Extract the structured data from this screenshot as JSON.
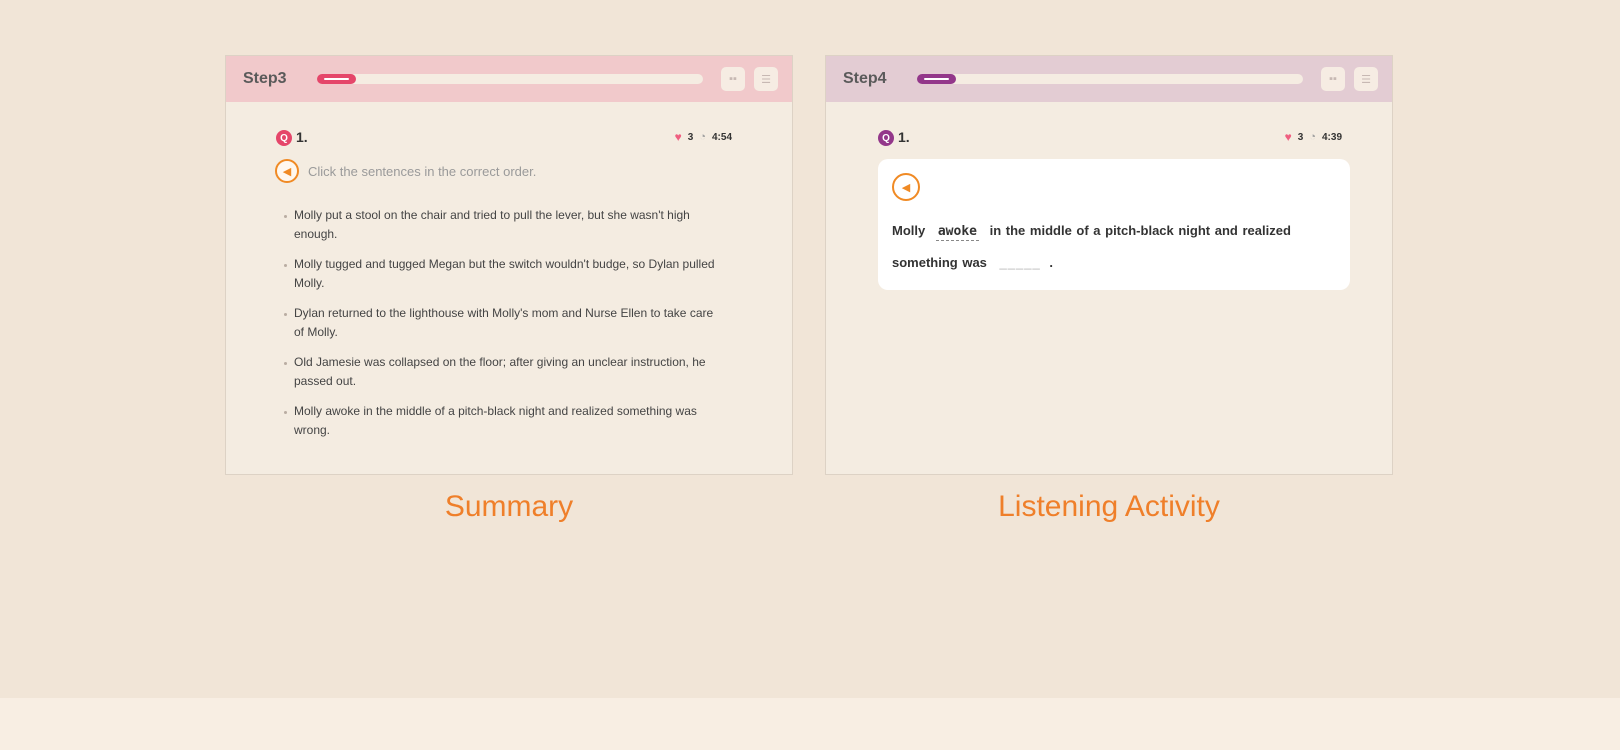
{
  "colors": {
    "background": "#f1e5d7",
    "accent_orange": "#ef7f2a",
    "step3_accent": "#e5466a",
    "step4_accent": "#93378a"
  },
  "summary_panel": {
    "step_title": "Step3",
    "progress_fraction": 0.1,
    "header_icons": [
      "grid-icon",
      "list-icon"
    ],
    "question_badge": "Q",
    "question_number": "1.",
    "hearts": "3",
    "timer": "4:54",
    "instruction": "Click the sentences in the correct order.",
    "sentences": [
      "Molly put a stool on the chair and tried to pull the lever, but she wasn't high enough.",
      "Molly tugged and tugged Megan but the switch wouldn't budge, so Dylan pulled Molly.",
      "Dylan returned to the lighthouse with Molly's mom and Nurse Ellen to take care of Molly.",
      "Old Jamesie was collapsed on the floor; after giving an unclear instruction, he passed out.",
      "Molly awoke in the middle of a pitch-black night and realized something was wrong."
    ],
    "caption": "Summary"
  },
  "listening_panel": {
    "step_title": "Step4",
    "progress_fraction": 0.1,
    "header_icons": [
      "grid-icon",
      "list-icon"
    ],
    "question_badge": "Q",
    "question_number": "1.",
    "hearts": "3",
    "timer": "4:39",
    "sentence_start": "Molly",
    "answer_word": "awoke",
    "sentence_middle": "in the middle of a pitch-black night and realized something was",
    "blank": "_____",
    "sentence_end": ".",
    "caption": "Listening Activity"
  }
}
